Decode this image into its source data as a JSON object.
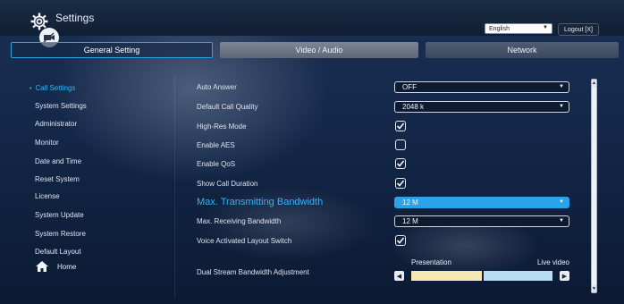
{
  "header": {
    "title": "Settings",
    "language": "English",
    "logout_label": "Logout [X]"
  },
  "tabs": [
    {
      "label": "General Setting",
      "active": true
    },
    {
      "label": "Video / Audio",
      "active": false
    },
    {
      "label": "Network",
      "active": false
    }
  ],
  "sidebar": {
    "items": [
      {
        "label": "Call Settings",
        "active": true
      },
      {
        "label": "System Settings"
      },
      {
        "label": "Administrator"
      },
      {
        "label": "Monitor"
      },
      {
        "label": "Date and Time"
      },
      {
        "label": "Reset System"
      },
      {
        "label": "License"
      },
      {
        "label": "System Update"
      },
      {
        "label": "System Restore"
      },
      {
        "label": "Default Layout"
      }
    ],
    "home_label": "Home"
  },
  "settings": {
    "auto_answer": {
      "label": "Auto Answer",
      "value": "OFF"
    },
    "default_call_quality": {
      "label": "Default Call Quality",
      "value": "2048 k"
    },
    "high_res_mode": {
      "label": "High-Res Mode",
      "checked": true
    },
    "enable_aes": {
      "label": "Enable AES",
      "checked": false
    },
    "enable_qos": {
      "label": "Enable QoS",
      "checked": true
    },
    "show_call_duration": {
      "label": "Show Call Duration",
      "checked": true
    },
    "max_tx_bandwidth": {
      "label": "Max. Transmitting Bandwidth",
      "value": "12 M"
    },
    "max_rx_bandwidth": {
      "label": "Max. Receiving Bandwidth",
      "value": "12 M"
    },
    "voice_activated_layout": {
      "label": "Voice Activated Layout Switch",
      "checked": true
    },
    "dual_stream": {
      "label": "Dual Stream Bandwidth Adjustment",
      "left_label": "Presentation",
      "right_label": "Live video",
      "presentation_share": 0.5
    }
  },
  "colors": {
    "accent": "#2aa3e8",
    "active_text": "#37b3f4",
    "presentation_bar": "#f6e8b2",
    "live_bar": "#b8dcf2"
  }
}
